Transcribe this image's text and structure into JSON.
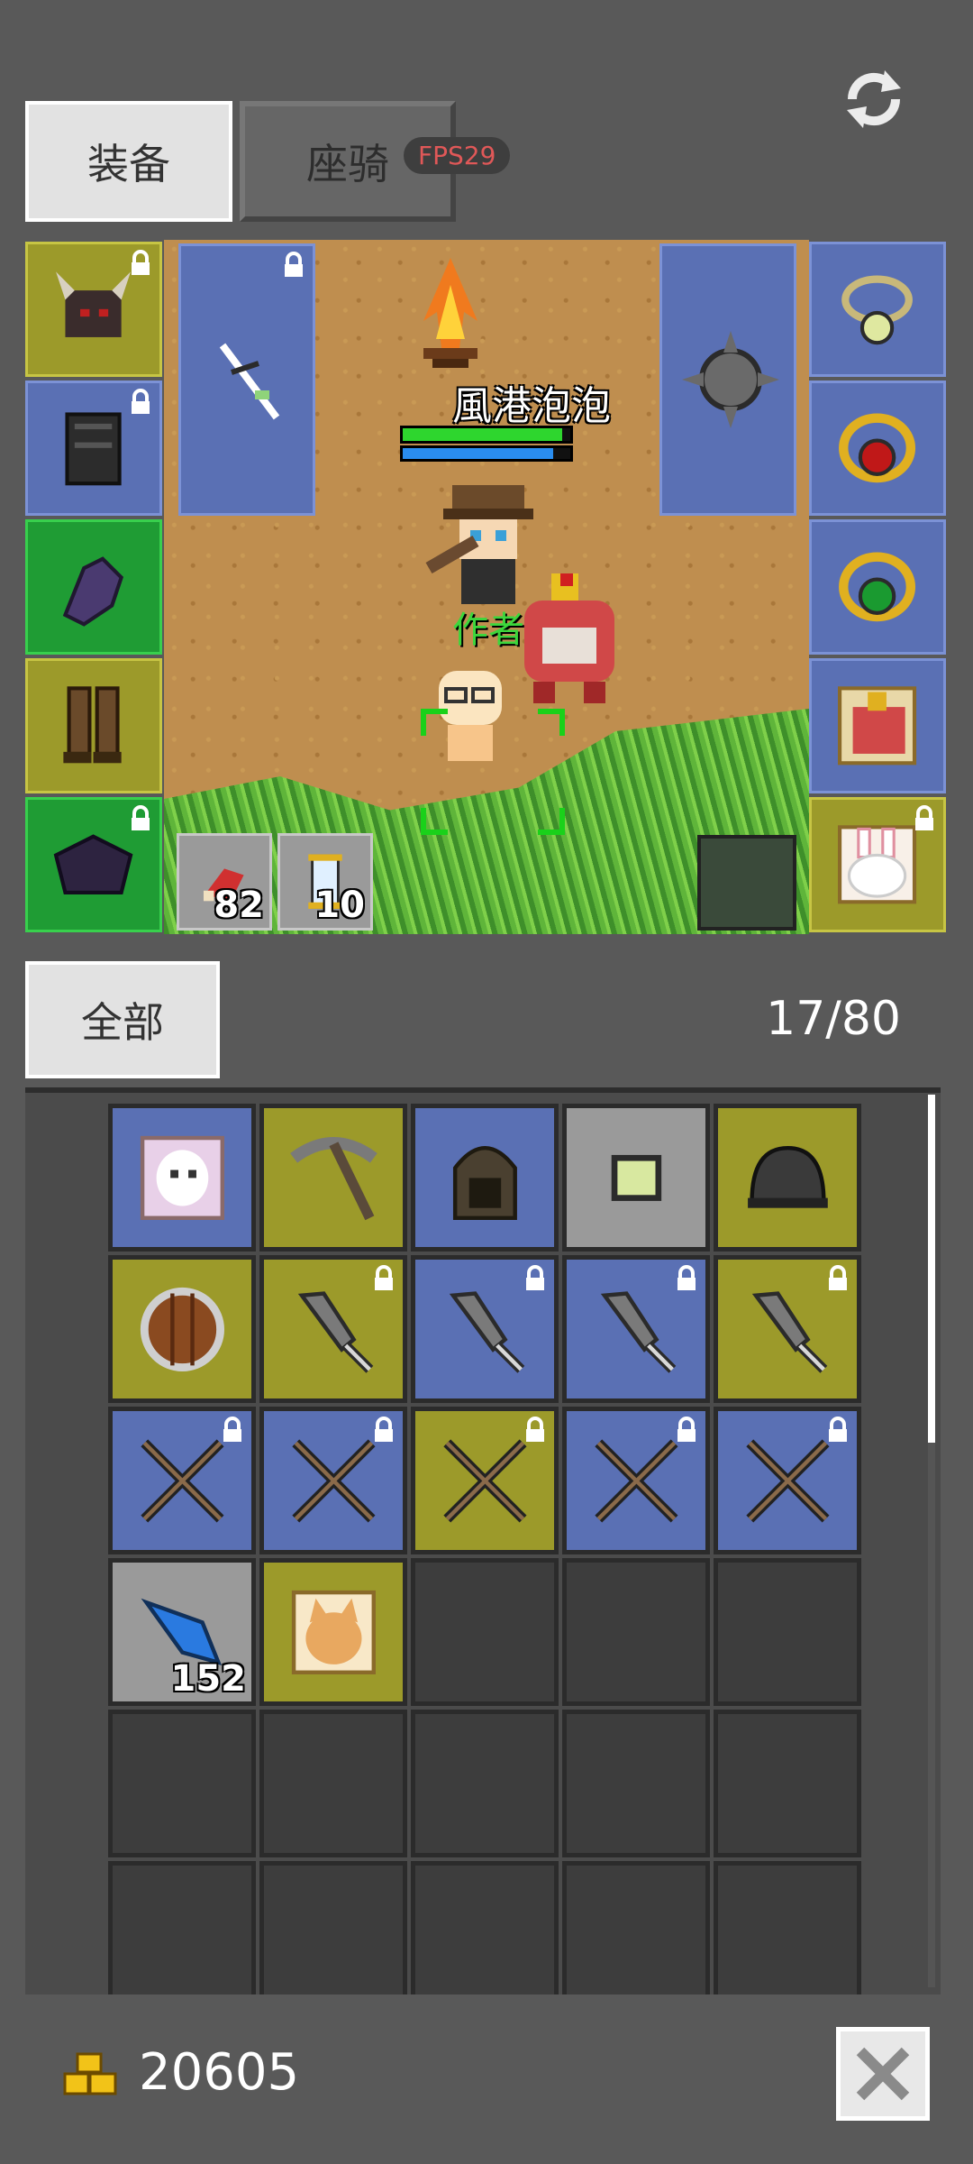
{
  "tabs": {
    "equip_label": "装备",
    "mount_label": "座骑"
  },
  "fps_badge": "FPS29",
  "scene": {
    "player_name": "風港泡泡",
    "hp_fraction": 0.95,
    "mp_fraction": 0.9,
    "pet_owner_label": "作者"
  },
  "equip_left": [
    {
      "name": "helmet-slot",
      "color": "yellow",
      "icon": "horned-helmet-icon",
      "locked": true
    },
    {
      "name": "armor-slot",
      "color": "blue",
      "icon": "dark-armor-icon",
      "locked": true
    },
    {
      "name": "gloves-slot",
      "color": "green",
      "icon": "purple-glove-icon",
      "locked": false
    },
    {
      "name": "boots-slot",
      "color": "yellow",
      "icon": "leather-boots-icon",
      "locked": false
    },
    {
      "name": "cape-slot",
      "color": "green",
      "icon": "purple-cape-icon",
      "locked": true
    }
  ],
  "equip_right": [
    {
      "name": "necklace-slot",
      "color": "blue",
      "icon": "pale-gem-ring-icon",
      "locked": false
    },
    {
      "name": "ring-red-slot",
      "color": "blue",
      "icon": "ruby-ring-icon",
      "locked": false
    },
    {
      "name": "ring-green-slot",
      "color": "blue",
      "icon": "emerald-ring-icon",
      "locked": false
    },
    {
      "name": "mount-card-slot",
      "color": "blue",
      "icon": "dragon-card-icon",
      "locked": false
    },
    {
      "name": "pet-card-slot",
      "color": "yellow",
      "icon": "rabbit-card-icon",
      "locked": true
    }
  ],
  "weapon_slots": [
    {
      "name": "main-weapon-slot",
      "icon": "white-bow-icon",
      "locked": true
    },
    {
      "name": "offhand-weapon-slot",
      "icon": "spiked-mace-icon",
      "locked": false
    }
  ],
  "quickbar": [
    {
      "name": "quick-slot-meat",
      "icon": "meat-icon",
      "count": "82"
    },
    {
      "name": "quick-slot-scroll",
      "icon": "scroll-icon",
      "count": "10"
    }
  ],
  "bag": {
    "filter_label": "全部",
    "count_label": "17/80",
    "items": [
      {
        "color": "blue",
        "icon": "ghost-card-icon",
        "locked": false,
        "count": ""
      },
      {
        "color": "yellow",
        "icon": "pickaxe-icon",
        "locked": false,
        "count": ""
      },
      {
        "color": "blue",
        "icon": "hood-icon",
        "locked": false,
        "count": ""
      },
      {
        "color": "gray",
        "icon": "green-gem-icon",
        "locked": false,
        "count": ""
      },
      {
        "color": "yellow",
        "icon": "iron-helmet-icon",
        "locked": false,
        "count": ""
      },
      {
        "color": "yellow",
        "icon": "round-shield-icon",
        "locked": false,
        "count": ""
      },
      {
        "color": "yellow",
        "icon": "dagger-icon",
        "locked": true,
        "count": ""
      },
      {
        "color": "blue",
        "icon": "dagger-icon",
        "locked": true,
        "count": ""
      },
      {
        "color": "blue",
        "icon": "dagger-icon",
        "locked": true,
        "count": ""
      },
      {
        "color": "yellow",
        "icon": "dagger-icon",
        "locked": true,
        "count": ""
      },
      {
        "color": "blue",
        "icon": "crossed-spears-icon",
        "locked": true,
        "count": ""
      },
      {
        "color": "blue",
        "icon": "crossed-spears-icon",
        "locked": true,
        "count": ""
      },
      {
        "color": "yellow",
        "icon": "crossed-spears-icon",
        "locked": true,
        "count": ""
      },
      {
        "color": "blue",
        "icon": "crossed-spears-icon",
        "locked": true,
        "count": ""
      },
      {
        "color": "blue",
        "icon": "crossed-spears-icon",
        "locked": true,
        "count": ""
      },
      {
        "color": "gray",
        "icon": "blue-feather-icon",
        "locked": false,
        "count": "152"
      },
      {
        "color": "yellow",
        "icon": "cat-card-icon",
        "locked": false,
        "count": ""
      }
    ],
    "visible_cells": 30
  },
  "gold": "20605",
  "colors": {
    "yellow": "#9c9a2a",
    "blue": "#5a70b4",
    "green": "#1f9c34",
    "gray": "#9a9a9a",
    "empty": "#3d3d3d"
  }
}
